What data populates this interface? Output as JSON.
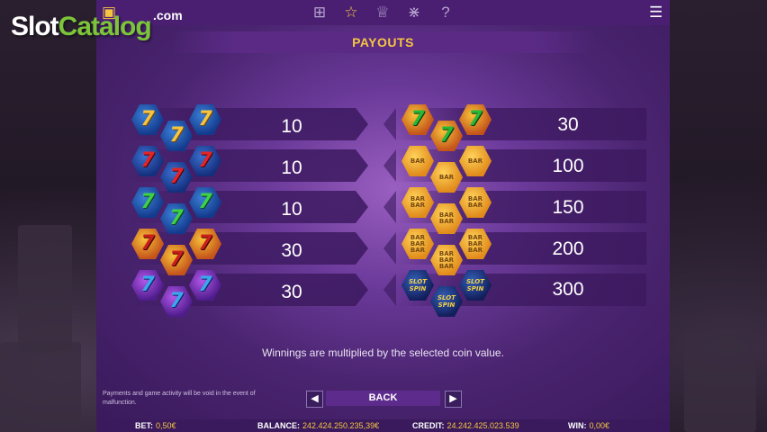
{
  "logo": {
    "slot": "Slot",
    "catalog": "Catalog",
    "com": ".com"
  },
  "topbar": {
    "icons": [
      "screen-icon",
      "paytable-grid-icon",
      "star-icon",
      "trophy-icon",
      "network-icon",
      "help-icon"
    ],
    "menu_icon": "menu-icon",
    "icon_glyphs": {
      "screen": "▣",
      "grid": "⊞",
      "star": "☆",
      "trophy": "♕",
      "network": "⋇",
      "help": "?",
      "menu": "☰"
    }
  },
  "title": "PAYOUTS",
  "left_column": [
    {
      "symbol": "gold-seven-blue",
      "payout": "10"
    },
    {
      "symbol": "red-seven-blue",
      "payout": "10"
    },
    {
      "symbol": "green-seven-blue",
      "payout": "10"
    },
    {
      "symbol": "red-seven-fire",
      "payout": "30"
    },
    {
      "symbol": "blue-seven-purple",
      "payout": "30"
    }
  ],
  "right_column": [
    {
      "symbol": "green-seven-fire",
      "payout": "30"
    },
    {
      "symbol": "single-bar",
      "payout": "100"
    },
    {
      "symbol": "double-bar",
      "payout": "150"
    },
    {
      "symbol": "triple-bar",
      "payout": "200"
    },
    {
      "symbol": "spinnit-seven",
      "payout": "300"
    }
  ],
  "symbol_text": {
    "seven": "7",
    "bar": "BAR",
    "spin": "SLOT SPIN"
  },
  "note": "Winnings are multiplied by the selected coin value.",
  "disclaimer": "Payments and game activity will be void in the event of malfunction.",
  "nav": {
    "prev": "◀",
    "back": "BACK",
    "next": "▶"
  },
  "status": {
    "bet_label": "BET:",
    "bet_value": "0,50€",
    "balance_label": "BALANCE:",
    "balance_value": "242.424.250.235,39€",
    "credit_label": "CREDIT:",
    "credit_value": "24.242.425.023.539",
    "win_label": "WIN:",
    "win_value": "0,00€"
  },
  "colors": {
    "accent": "#f5c542",
    "panel": "#4a2470",
    "brand_green": "#7cc53a"
  }
}
